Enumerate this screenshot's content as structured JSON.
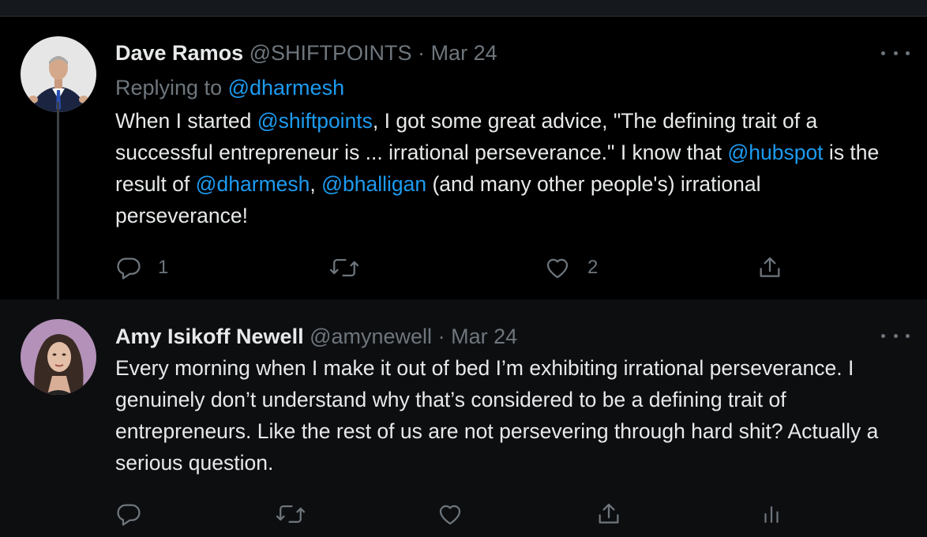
{
  "tweets": [
    {
      "author": "Dave Ramos",
      "handle": "@SHIFTPOINTS",
      "separator": "·",
      "date": "Mar 24",
      "replying_prefix": "Replying to",
      "replying_to": "@dharmesh",
      "body": {
        "t1": "When I started ",
        "m1": "@shiftpoints",
        "t2": ", I got some great advice, \"The defining trait of a successful entrepreneur is ... irrational perseverance.\" I know that ",
        "m2": "@hubspot",
        "t3": " is the result of ",
        "m3": "@dharmesh",
        "t4": ", ",
        "m4": "@bhalligan",
        "t5": " (and many other people's) irrational perseverance!"
      },
      "reply_count": "1",
      "like_count": "2"
    },
    {
      "author": "Amy Isikoff Newell",
      "handle": "@amynewell",
      "separator": "·",
      "date": "Mar 24",
      "body": "Every morning when I make it out of bed I’m exhibiting irrational perseverance. I genuinely don’t understand why that’s considered to be a defining trait of entrepreneurs. Like the rest of us are not persevering through hard shit? Actually a serious question."
    }
  ],
  "icons": {
    "reply": "reply-icon",
    "retweet": "retweet-icon",
    "like": "heart-icon",
    "share": "share-icon",
    "analytics": "analytics-icon",
    "more": "more-icon"
  },
  "colors": {
    "background": "#000000",
    "reply_background": "#0d0e10",
    "text": "#e7e9ea",
    "muted": "#6e767d",
    "link": "#1d9bf0"
  }
}
